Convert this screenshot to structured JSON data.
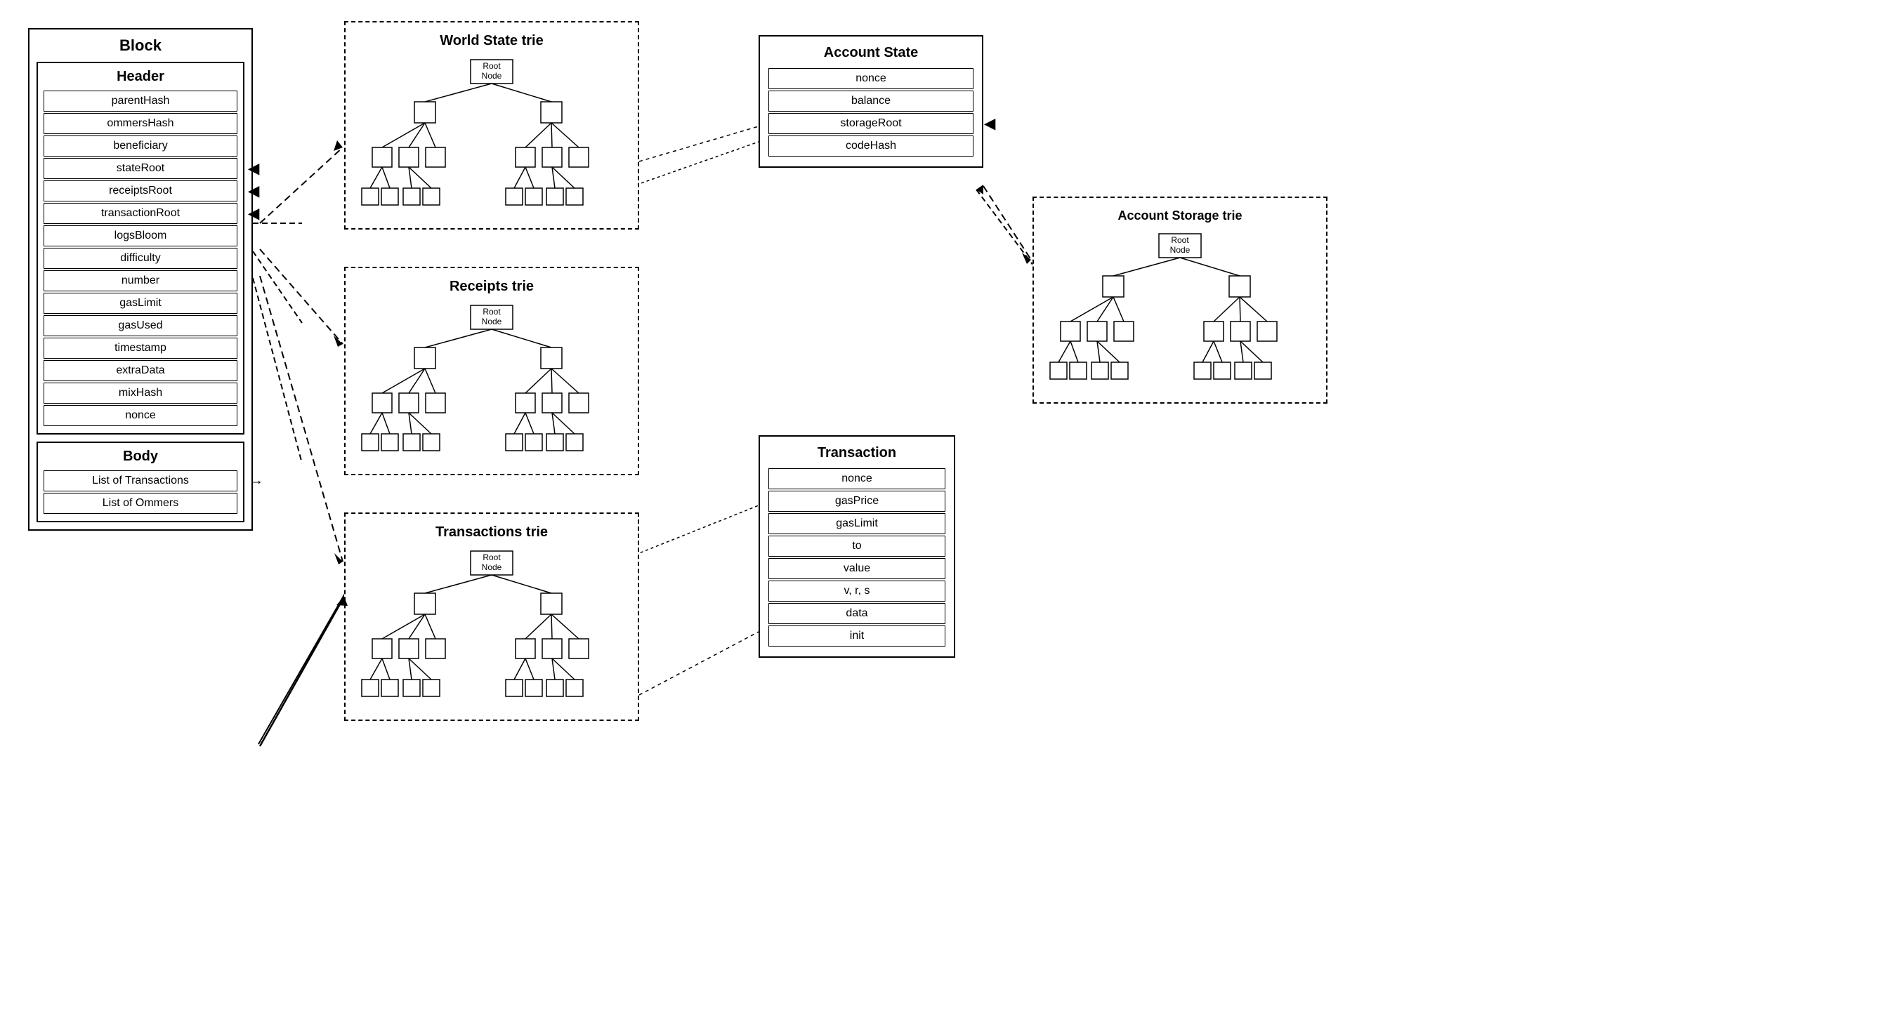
{
  "block": {
    "title": "Block",
    "header": {
      "title": "Header",
      "fields": [
        "parentHash",
        "ommersHash",
        "beneficiary",
        "stateRoot",
        "receiptsRoot",
        "transactionRoot",
        "logsBloom",
        "difficulty",
        "number",
        "gasLimit",
        "gasUsed",
        "timestamp",
        "extraData",
        "mixHash",
        "nonce"
      ],
      "arrow_fields": [
        "stateRoot",
        "receiptsRoot",
        "transactionRoot"
      ]
    },
    "body": {
      "title": "Body",
      "fields": [
        "List of Transactions",
        "List of Ommers"
      ]
    }
  },
  "world_state_trie": {
    "title": "World State trie",
    "root_node": "Root\nNode"
  },
  "receipts_trie": {
    "title": "Receipts trie",
    "root_node": "Root\nNode"
  },
  "transactions_trie": {
    "title": "Transactions trie",
    "root_node": "Root\nNode"
  },
  "account_state": {
    "title": "Account State",
    "fields": [
      "nonce",
      "balance",
      "storageRoot",
      "codeHash"
    ]
  },
  "transaction": {
    "title": "Transaction",
    "fields": [
      "nonce",
      "gasPrice",
      "gasLimit",
      "to",
      "value",
      "v, r, s",
      "data",
      "init"
    ]
  },
  "account_storage_trie": {
    "title": "Account Storage trie",
    "root_node": "Root\nNode"
  }
}
